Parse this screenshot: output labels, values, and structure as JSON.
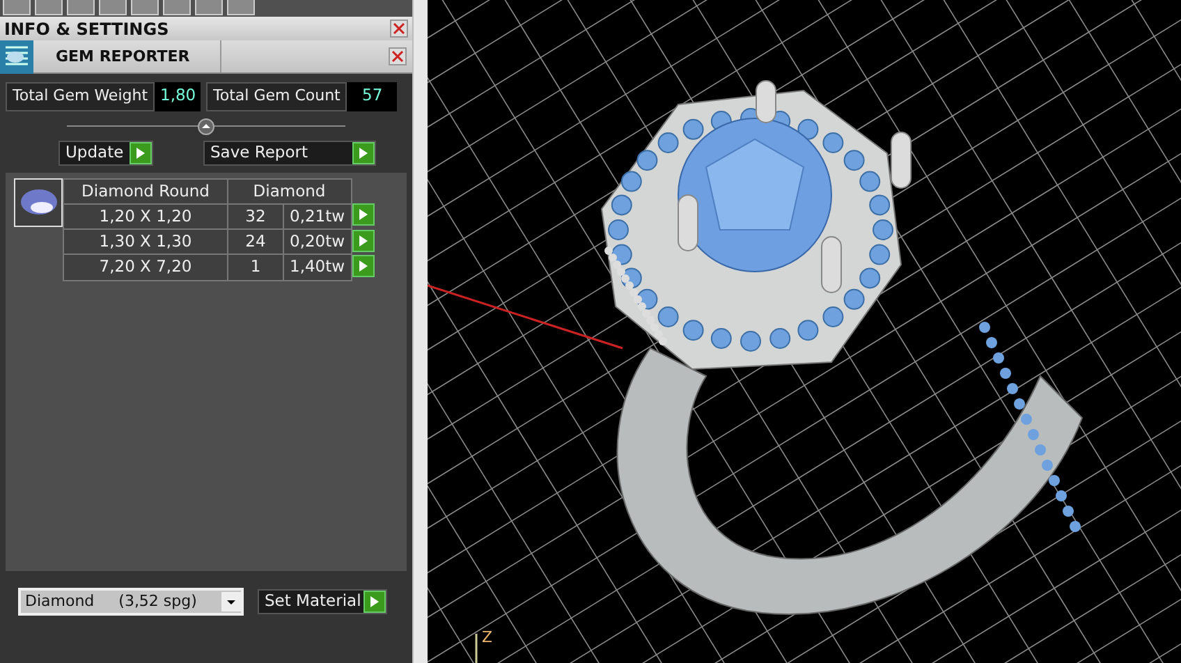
{
  "panel_title": "INFO & SETTINGS",
  "reporter_title": "GEM REPORTER",
  "totals": [
    {
      "label": "Total Gem Weight",
      "value": "1,80"
    },
    {
      "label": "Total Gem Count",
      "value": "57"
    }
  ],
  "actions": [
    "Update",
    "Save Report"
  ],
  "gem_table": {
    "columns": [
      "Diamond Round",
      "Diamond"
    ],
    "rows": [
      {
        "size": "1,20 X 1,20",
        "count": "32",
        "weight": "0,21tw"
      },
      {
        "size": "1,30 X 1,30",
        "count": "24",
        "weight": "0,20tw"
      },
      {
        "size": "7,20 X 7,20",
        "count": "1",
        "weight": "1,40tw"
      }
    ]
  },
  "material": {
    "value": "Diamond     (3,52 spg)",
    "button": "Set Material"
  },
  "viewport": {
    "axis_label": "Z"
  }
}
